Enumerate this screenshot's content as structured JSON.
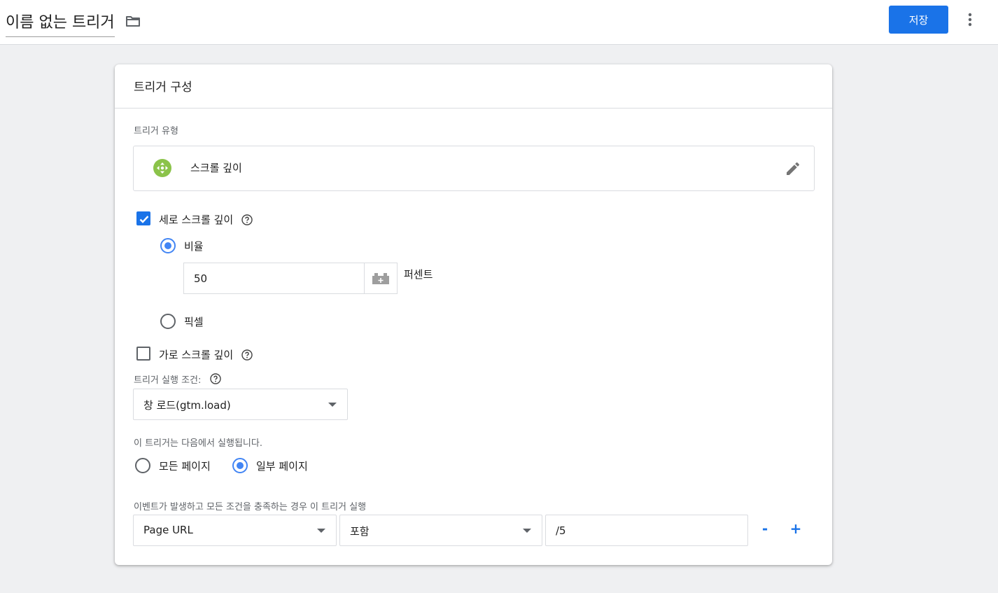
{
  "header": {
    "title": "이름 없는 트리거",
    "save_label": "저장"
  },
  "card": {
    "title": "트리거 구성",
    "trigger_type_label": "트리거 유형",
    "trigger_type_name": "스크롤 깊이",
    "vertical": {
      "label": "세로 스크롤 깊이",
      "checked": true,
      "percent_label": "비율",
      "percent_selected": true,
      "percent_value": "50",
      "percent_unit": "퍼센트",
      "pixels_label": "픽셀",
      "pixels_selected": false
    },
    "horizontal": {
      "label": "가로 스크롤 깊이",
      "checked": false
    },
    "fire_on_label": "트리거 실행 조건:",
    "fire_on_value": "창 로드(gtm.load)",
    "fires_on_label": "이 트리거는 다음에서 실행됩니다.",
    "all_pages_label": "모든 페이지",
    "some_pages_label": "일부 페이지",
    "some_pages_selected": true,
    "condition_label": "이벤트가 발생하고 모든 조건을 충족하는 경우 이 트리거 실행",
    "condition": {
      "variable": "Page URL",
      "operator": "포함",
      "value": "/5"
    },
    "minus_label": "-",
    "plus_label": "+"
  },
  "colors": {
    "accent": "#1a73e8",
    "radio_on": "#4285f4",
    "type_icon": "#8bc34a"
  }
}
